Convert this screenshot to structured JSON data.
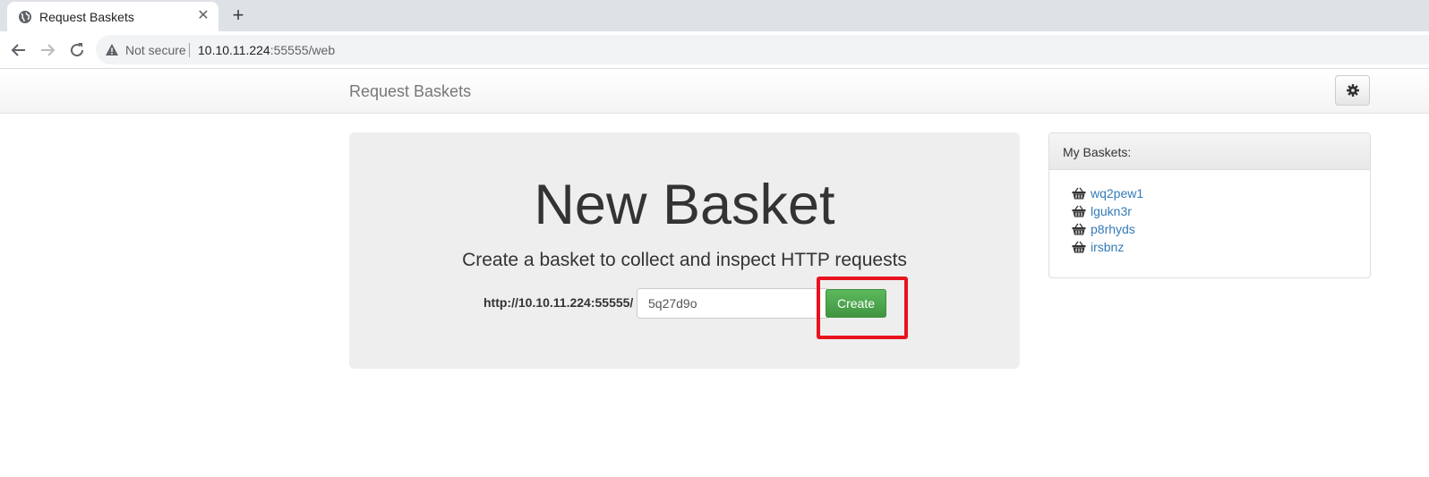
{
  "browser": {
    "tab_title": "Request Baskets",
    "tab_icon": "globe-icon",
    "security_label": "Not secure",
    "url_host": "10.10.11.224",
    "url_rest": ":55555/web"
  },
  "navbar": {
    "brand": "Request Baskets",
    "settings_icon": "gear-icon"
  },
  "main": {
    "title": "New Basket",
    "subtitle": "Create a basket to collect and inspect HTTP requests",
    "url_prefix": "http://10.10.11.224:55555/",
    "basket_name_value": "5q27d9o",
    "create_label": "Create"
  },
  "sidebar": {
    "heading": "My Baskets:",
    "baskets": [
      "wq2pew1",
      "lgukn3r",
      "p8rhyds",
      "irsbnz"
    ]
  },
  "colors": {
    "create_button": "#4cae4c",
    "link": "#337ab7",
    "highlight_box": "#e8121e"
  }
}
